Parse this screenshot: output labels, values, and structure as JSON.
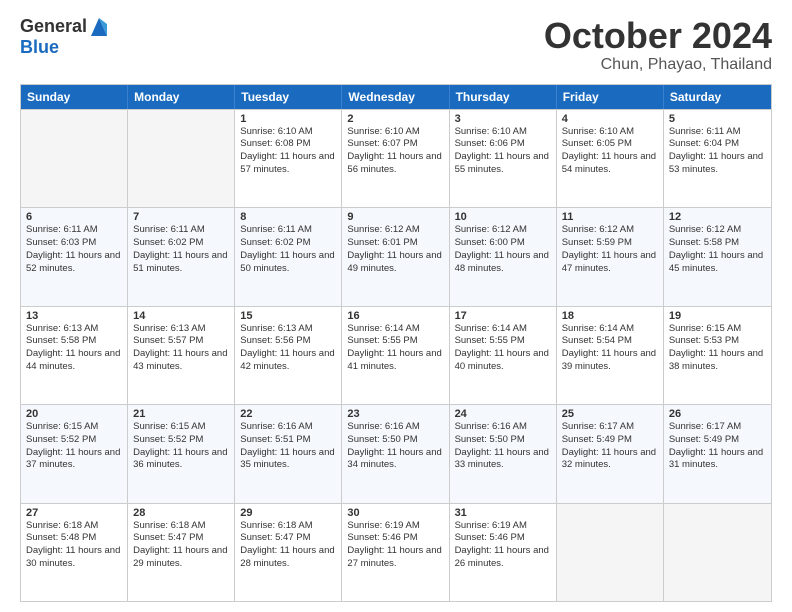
{
  "logo": {
    "general": "General",
    "blue": "Blue"
  },
  "title": "October 2024",
  "location": "Chun, Phayao, Thailand",
  "header_days": [
    "Sunday",
    "Monday",
    "Tuesday",
    "Wednesday",
    "Thursday",
    "Friday",
    "Saturday"
  ],
  "weeks": [
    [
      {
        "day": "",
        "sunrise": "",
        "sunset": "",
        "daylight": "",
        "empty": true
      },
      {
        "day": "",
        "sunrise": "",
        "sunset": "",
        "daylight": "",
        "empty": true
      },
      {
        "day": "1",
        "sunrise": "Sunrise: 6:10 AM",
        "sunset": "Sunset: 6:08 PM",
        "daylight": "Daylight: 11 hours and 57 minutes."
      },
      {
        "day": "2",
        "sunrise": "Sunrise: 6:10 AM",
        "sunset": "Sunset: 6:07 PM",
        "daylight": "Daylight: 11 hours and 56 minutes."
      },
      {
        "day": "3",
        "sunrise": "Sunrise: 6:10 AM",
        "sunset": "Sunset: 6:06 PM",
        "daylight": "Daylight: 11 hours and 55 minutes."
      },
      {
        "day": "4",
        "sunrise": "Sunrise: 6:10 AM",
        "sunset": "Sunset: 6:05 PM",
        "daylight": "Daylight: 11 hours and 54 minutes."
      },
      {
        "day": "5",
        "sunrise": "Sunrise: 6:11 AM",
        "sunset": "Sunset: 6:04 PM",
        "daylight": "Daylight: 11 hours and 53 minutes."
      }
    ],
    [
      {
        "day": "6",
        "sunrise": "Sunrise: 6:11 AM",
        "sunset": "Sunset: 6:03 PM",
        "daylight": "Daylight: 11 hours and 52 minutes."
      },
      {
        "day": "7",
        "sunrise": "Sunrise: 6:11 AM",
        "sunset": "Sunset: 6:02 PM",
        "daylight": "Daylight: 11 hours and 51 minutes."
      },
      {
        "day": "8",
        "sunrise": "Sunrise: 6:11 AM",
        "sunset": "Sunset: 6:02 PM",
        "daylight": "Daylight: 11 hours and 50 minutes."
      },
      {
        "day": "9",
        "sunrise": "Sunrise: 6:12 AM",
        "sunset": "Sunset: 6:01 PM",
        "daylight": "Daylight: 11 hours and 49 minutes."
      },
      {
        "day": "10",
        "sunrise": "Sunrise: 6:12 AM",
        "sunset": "Sunset: 6:00 PM",
        "daylight": "Daylight: 11 hours and 48 minutes."
      },
      {
        "day": "11",
        "sunrise": "Sunrise: 6:12 AM",
        "sunset": "Sunset: 5:59 PM",
        "daylight": "Daylight: 11 hours and 47 minutes."
      },
      {
        "day": "12",
        "sunrise": "Sunrise: 6:12 AM",
        "sunset": "Sunset: 5:58 PM",
        "daylight": "Daylight: 11 hours and 45 minutes."
      }
    ],
    [
      {
        "day": "13",
        "sunrise": "Sunrise: 6:13 AM",
        "sunset": "Sunset: 5:58 PM",
        "daylight": "Daylight: 11 hours and 44 minutes."
      },
      {
        "day": "14",
        "sunrise": "Sunrise: 6:13 AM",
        "sunset": "Sunset: 5:57 PM",
        "daylight": "Daylight: 11 hours and 43 minutes."
      },
      {
        "day": "15",
        "sunrise": "Sunrise: 6:13 AM",
        "sunset": "Sunset: 5:56 PM",
        "daylight": "Daylight: 11 hours and 42 minutes."
      },
      {
        "day": "16",
        "sunrise": "Sunrise: 6:14 AM",
        "sunset": "Sunset: 5:55 PM",
        "daylight": "Daylight: 11 hours and 41 minutes."
      },
      {
        "day": "17",
        "sunrise": "Sunrise: 6:14 AM",
        "sunset": "Sunset: 5:55 PM",
        "daylight": "Daylight: 11 hours and 40 minutes."
      },
      {
        "day": "18",
        "sunrise": "Sunrise: 6:14 AM",
        "sunset": "Sunset: 5:54 PM",
        "daylight": "Daylight: 11 hours and 39 minutes."
      },
      {
        "day": "19",
        "sunrise": "Sunrise: 6:15 AM",
        "sunset": "Sunset: 5:53 PM",
        "daylight": "Daylight: 11 hours and 38 minutes."
      }
    ],
    [
      {
        "day": "20",
        "sunrise": "Sunrise: 6:15 AM",
        "sunset": "Sunset: 5:52 PM",
        "daylight": "Daylight: 11 hours and 37 minutes."
      },
      {
        "day": "21",
        "sunrise": "Sunrise: 6:15 AM",
        "sunset": "Sunset: 5:52 PM",
        "daylight": "Daylight: 11 hours and 36 minutes."
      },
      {
        "day": "22",
        "sunrise": "Sunrise: 6:16 AM",
        "sunset": "Sunset: 5:51 PM",
        "daylight": "Daylight: 11 hours and 35 minutes."
      },
      {
        "day": "23",
        "sunrise": "Sunrise: 6:16 AM",
        "sunset": "Sunset: 5:50 PM",
        "daylight": "Daylight: 11 hours and 34 minutes."
      },
      {
        "day": "24",
        "sunrise": "Sunrise: 6:16 AM",
        "sunset": "Sunset: 5:50 PM",
        "daylight": "Daylight: 11 hours and 33 minutes."
      },
      {
        "day": "25",
        "sunrise": "Sunrise: 6:17 AM",
        "sunset": "Sunset: 5:49 PM",
        "daylight": "Daylight: 11 hours and 32 minutes."
      },
      {
        "day": "26",
        "sunrise": "Sunrise: 6:17 AM",
        "sunset": "Sunset: 5:49 PM",
        "daylight": "Daylight: 11 hours and 31 minutes."
      }
    ],
    [
      {
        "day": "27",
        "sunrise": "Sunrise: 6:18 AM",
        "sunset": "Sunset: 5:48 PM",
        "daylight": "Daylight: 11 hours and 30 minutes."
      },
      {
        "day": "28",
        "sunrise": "Sunrise: 6:18 AM",
        "sunset": "Sunset: 5:47 PM",
        "daylight": "Daylight: 11 hours and 29 minutes."
      },
      {
        "day": "29",
        "sunrise": "Sunrise: 6:18 AM",
        "sunset": "Sunset: 5:47 PM",
        "daylight": "Daylight: 11 hours and 28 minutes."
      },
      {
        "day": "30",
        "sunrise": "Sunrise: 6:19 AM",
        "sunset": "Sunset: 5:46 PM",
        "daylight": "Daylight: 11 hours and 27 minutes."
      },
      {
        "day": "31",
        "sunrise": "Sunrise: 6:19 AM",
        "sunset": "Sunset: 5:46 PM",
        "daylight": "Daylight: 11 hours and 26 minutes."
      },
      {
        "day": "",
        "sunrise": "",
        "sunset": "",
        "daylight": "",
        "empty": true
      },
      {
        "day": "",
        "sunrise": "",
        "sunset": "",
        "daylight": "",
        "empty": true
      }
    ]
  ]
}
